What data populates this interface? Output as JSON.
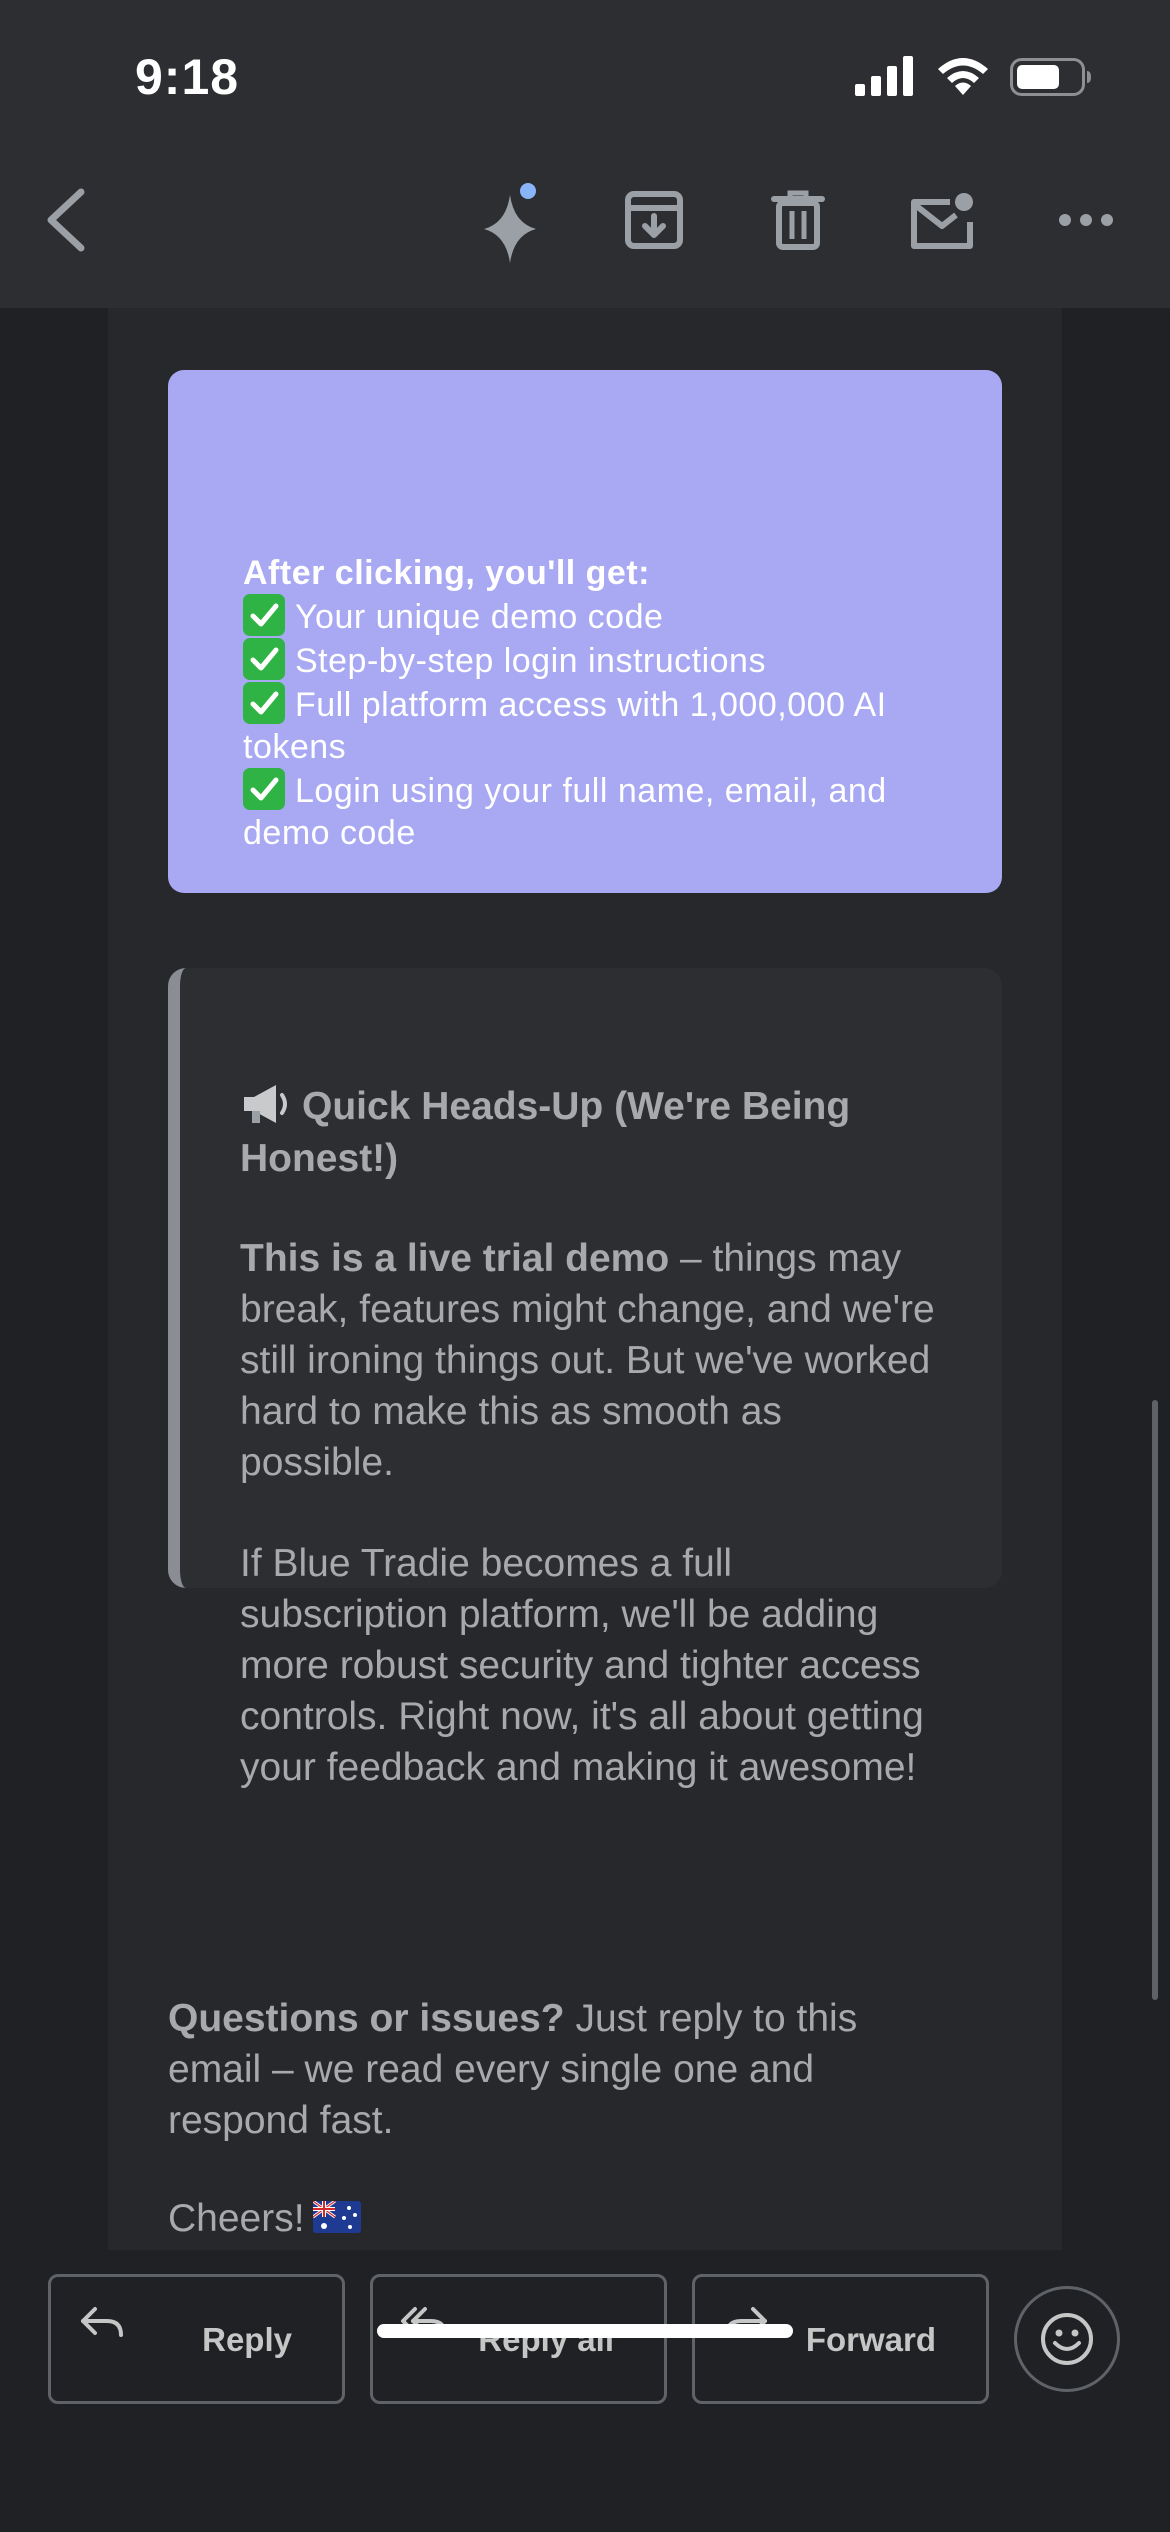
{
  "status_bar": {
    "time": "9:18"
  },
  "toolbar": {
    "icons": [
      "back-arrow-icon",
      "sparkle-icon",
      "archive-icon",
      "trash-icon",
      "mark-unread-icon",
      "more-icon"
    ]
  },
  "email": {
    "demo_box": {
      "heading": "After clicking, you'll get:",
      "items": [
        "Your unique demo code",
        "Step-by-step login instructions",
        "Full platform access with 1,000,000 AI tokens",
        "Login using your full name, email, and demo code"
      ]
    },
    "notice": {
      "title": "Quick Heads-Up (We're Being Honest!)",
      "p1_bold": "This is a live trial demo",
      "p1_rest": " – things may break, features might change, and we're still ironing things out. But we've worked hard to make this as smooth as possible.",
      "p2": "If Blue Tradie becomes a full subscription platform, we'll be adding more robust security and tighter access controls. Right now, it's all about getting your feedback and making it awesome!"
    },
    "questions_bold": "Questions or issues?",
    "questions_rest": " Just reply to this email – we read every single one and respond fast.",
    "signoff": "Cheers!"
  },
  "actions": {
    "reply": "Reply",
    "reply_all": "Reply all",
    "forward": "Forward"
  },
  "colors": {
    "accent_box": "#a8a8f3",
    "background": "#202124",
    "check_green": "#2fb344"
  }
}
